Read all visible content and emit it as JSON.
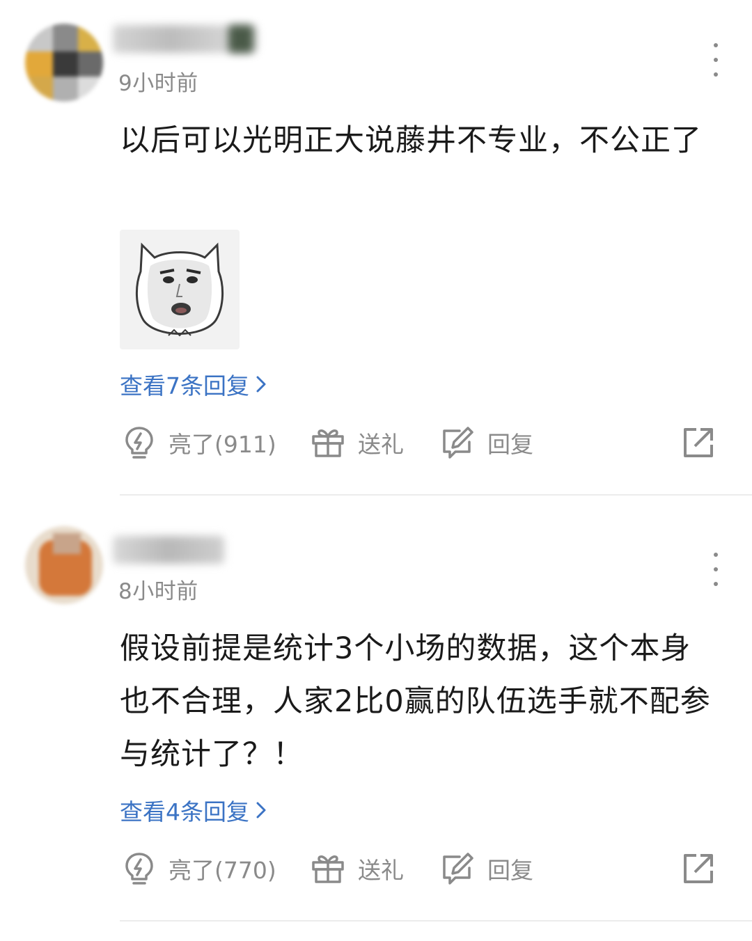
{
  "comments": [
    {
      "timestamp": "9小时前",
      "text": "以后可以光明正大说藤井不专业，不公正了",
      "has_sticker": true,
      "replies_label": "查看7条回复",
      "like_label": "亮了(911)",
      "gift_label": "送礼",
      "reply_label": "回复"
    },
    {
      "timestamp": "8小时前",
      "text": "假设前提是统计3个小场的数据，这个本身也不合理，人家2比0赢的队伍选手就不配参与统计了？！",
      "has_sticker": false,
      "replies_label": "查看4条回复",
      "like_label": "亮了(770)",
      "gift_label": "送礼",
      "reply_label": "回复"
    }
  ],
  "colors": {
    "link": "#3b73c4",
    "muted": "#8a8a8a",
    "text": "#1a1a1a",
    "divider": "#ececec"
  },
  "icons": [
    "lightbulb-icon",
    "gift-icon",
    "edit-reply-icon",
    "share-icon",
    "more-vertical-icon",
    "chevron-right-icon"
  ]
}
